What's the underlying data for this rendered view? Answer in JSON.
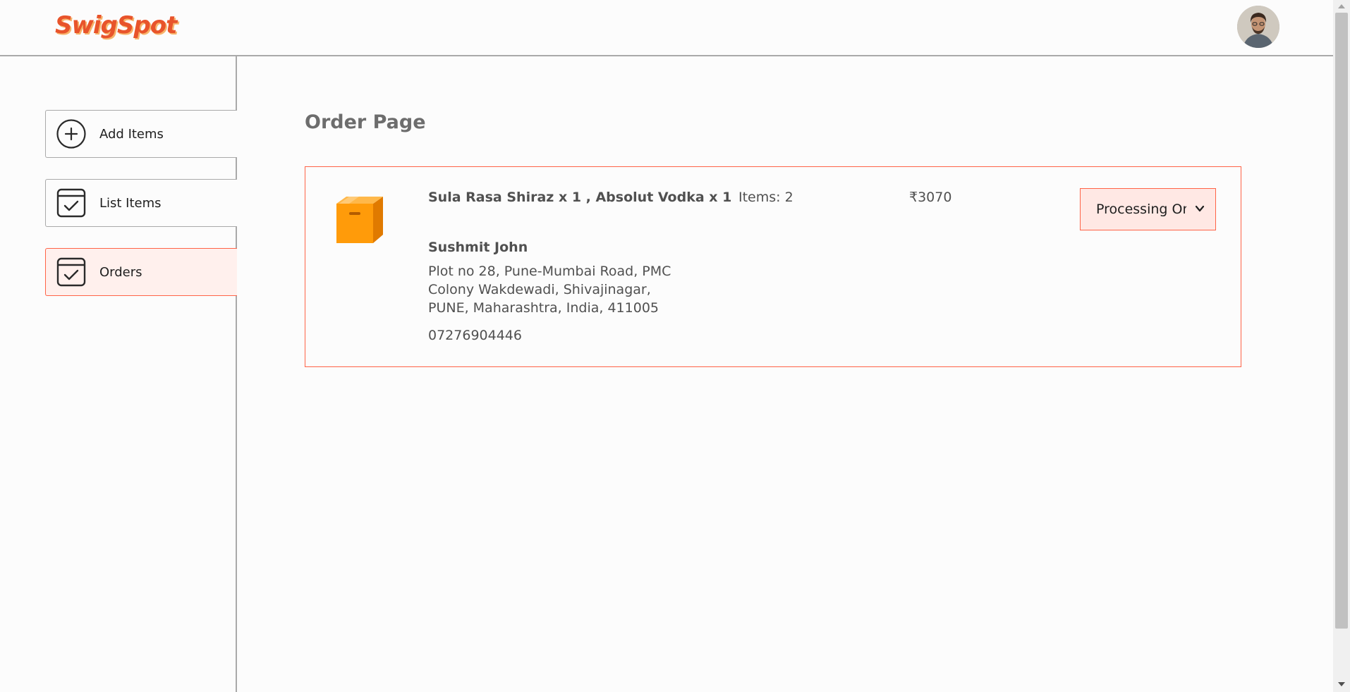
{
  "header": {
    "logo_text": "SwigSpot",
    "avatar_alt": "profile"
  },
  "sidebar": {
    "items": [
      {
        "label": "Add Items",
        "icon": "plus-circle-icon"
      },
      {
        "label": "List Items",
        "icon": "checkbox-calendar-icon"
      },
      {
        "label": "Orders",
        "icon": "checkbox-calendar-icon",
        "active": true
      }
    ]
  },
  "main": {
    "title": "Order Page",
    "orders": [
      {
        "items_text": "Sula Rasa Shiraz x 1 , Absolut Vodka x 1",
        "customer_name": "Sushmit John",
        "address": "Plot no 28, Pune-Mumbai Road, PMC Colony Wakdewadi, Shivajinagar, PUNE, Maharashtra, India, 411005",
        "phone": "07276904446",
        "items_count": "Items: 2",
        "amount": "₹3070",
        "status": "Processing Order",
        "icon": "parcel-box-icon"
      }
    ]
  },
  "colors": {
    "accent": "#ff6347",
    "active_bg": "#fff0ed",
    "logo": "#e8542b"
  }
}
